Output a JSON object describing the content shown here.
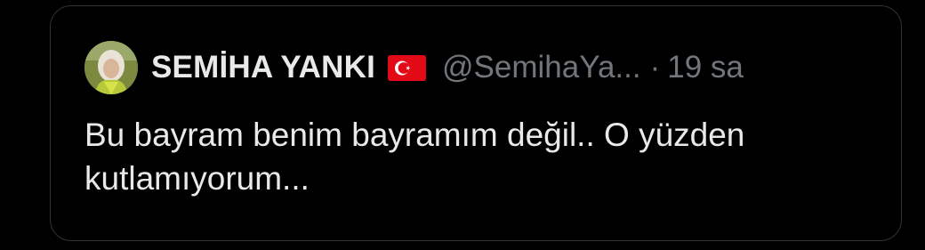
{
  "tweet": {
    "display_name": "SEMİHA YANKI",
    "handle": "@SemihaYa...",
    "separator": "·",
    "timestamp": "19 sa",
    "text": "Bu bayram benim bayramım değil.. O yüzden kutlamıyorum...",
    "flag_icon": "turkey-flag-icon",
    "avatar_icon": "user-avatar"
  },
  "colors": {
    "background": "#000000",
    "border": "#2f3336",
    "primary_text": "#e7e9ea",
    "secondary_text": "#71767b",
    "flag_red": "#e30a17"
  }
}
